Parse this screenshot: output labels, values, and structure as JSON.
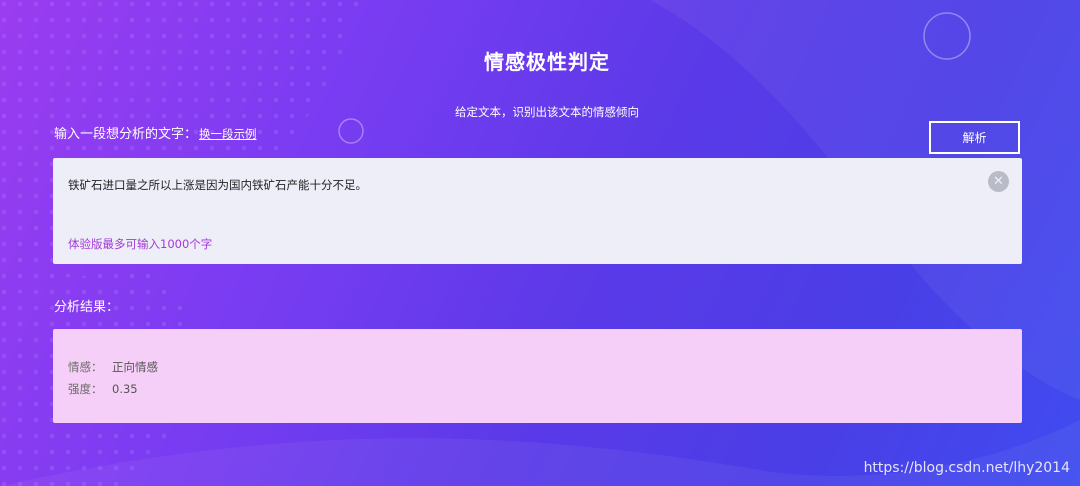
{
  "page": {
    "title": "情感极性判定",
    "subtitle": "给定文本，识别出该文本的情感倾向"
  },
  "input": {
    "label": "输入一段想分析的文字：",
    "example_link": "换一段示例",
    "value": "铁矿石进口量之所以上涨是因为国内铁矿石产能十分不足。",
    "limit_note": "体验版最多可输入1000个字",
    "clear_icon": "close-circle-icon"
  },
  "actions": {
    "analyze_label": "解析"
  },
  "result": {
    "label": "分析结果：",
    "sentiment_key": "情感：",
    "sentiment_value": "正向情感",
    "strength_key": "强度：",
    "strength_value": "0.35"
  },
  "watermark": "https://blog.csdn.net/lhy2014",
  "colors": {
    "bg_start": "#9b3cf0",
    "bg_end": "#3f4cf0",
    "input_bg": "#eeeef9",
    "result_bg": "#f5cff7",
    "limit_text": "#a33ad6"
  }
}
